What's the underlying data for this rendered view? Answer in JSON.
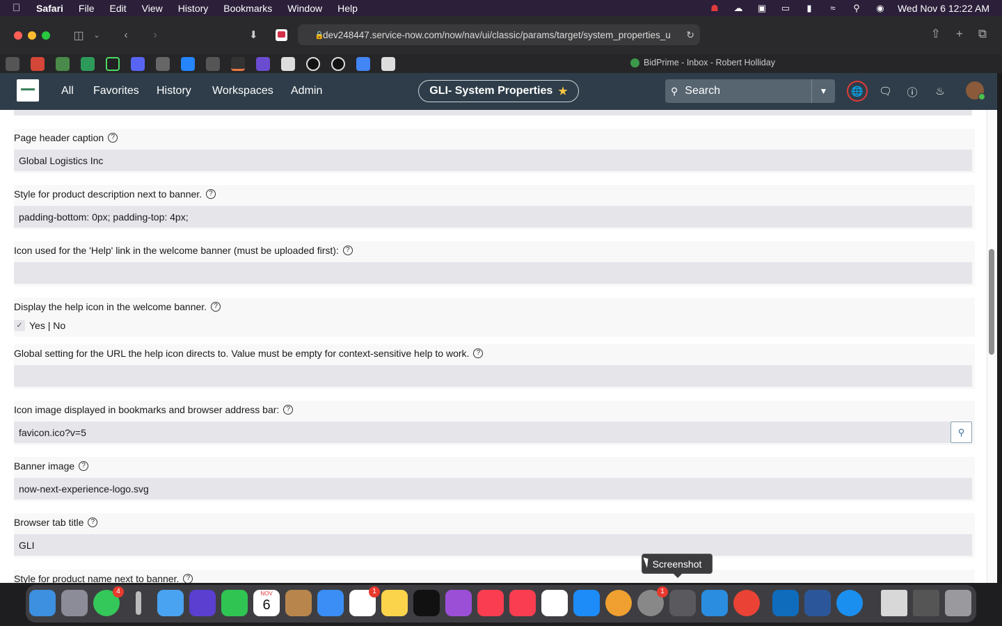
{
  "menubar": {
    "app": "Safari",
    "items": [
      "File",
      "Edit",
      "View",
      "History",
      "Bookmarks",
      "Window",
      "Help"
    ],
    "clock": "Wed Nov 6  12:22 AM"
  },
  "browser": {
    "url": "dev248447.service-now.com/now/nav/ui/classic/params/target/system_properties_u",
    "pinned_tab_label": "BidPrime - Inbox - Robert Holliday"
  },
  "snheader": {
    "nav": [
      "All",
      "Favorites",
      "History",
      "Workspaces",
      "Admin"
    ],
    "context_title": "GLI- System Properties",
    "search_label": "Search"
  },
  "properties": {
    "page_header_caption": {
      "label": "Page header caption",
      "value": "Global Logistics Inc"
    },
    "product_desc_style": {
      "label": "Style for product description next to banner.",
      "value": "padding-bottom: 0px; padding-top: 4px;"
    },
    "help_icon": {
      "label": "Icon used for the 'Help' link in the welcome banner (must be uploaded first):",
      "value": ""
    },
    "display_help_icon": {
      "label": "Display the help icon in the welcome banner.",
      "option": "Yes | No",
      "checked": true
    },
    "help_url": {
      "label": "Global setting for the URL the help icon directs to. Value must be empty for context-sensitive help to work.",
      "value": ""
    },
    "favicon": {
      "label": "Icon image displayed in bookmarks and browser address bar:",
      "value": "favicon.ico?v=5"
    },
    "banner_image": {
      "label": "Banner image",
      "value": "now-next-experience-logo.svg"
    },
    "browser_tab_title": {
      "label": "Browser tab title",
      "value": "GLI"
    },
    "product_name_style": {
      "label": "Style for product name next to banner."
    }
  },
  "dock": {
    "calendar_month": "NOV",
    "calendar_day": "6",
    "messages_badge": "4",
    "reminders_badge": "1",
    "settings_badge": "1",
    "tooltip": "Screenshot"
  },
  "colors": {
    "menubar_bg": "#2b1f3a",
    "sn_header_bg": "#2e3d49",
    "field_bg": "#e5e5ea",
    "accent_red": "#e03a3a"
  }
}
